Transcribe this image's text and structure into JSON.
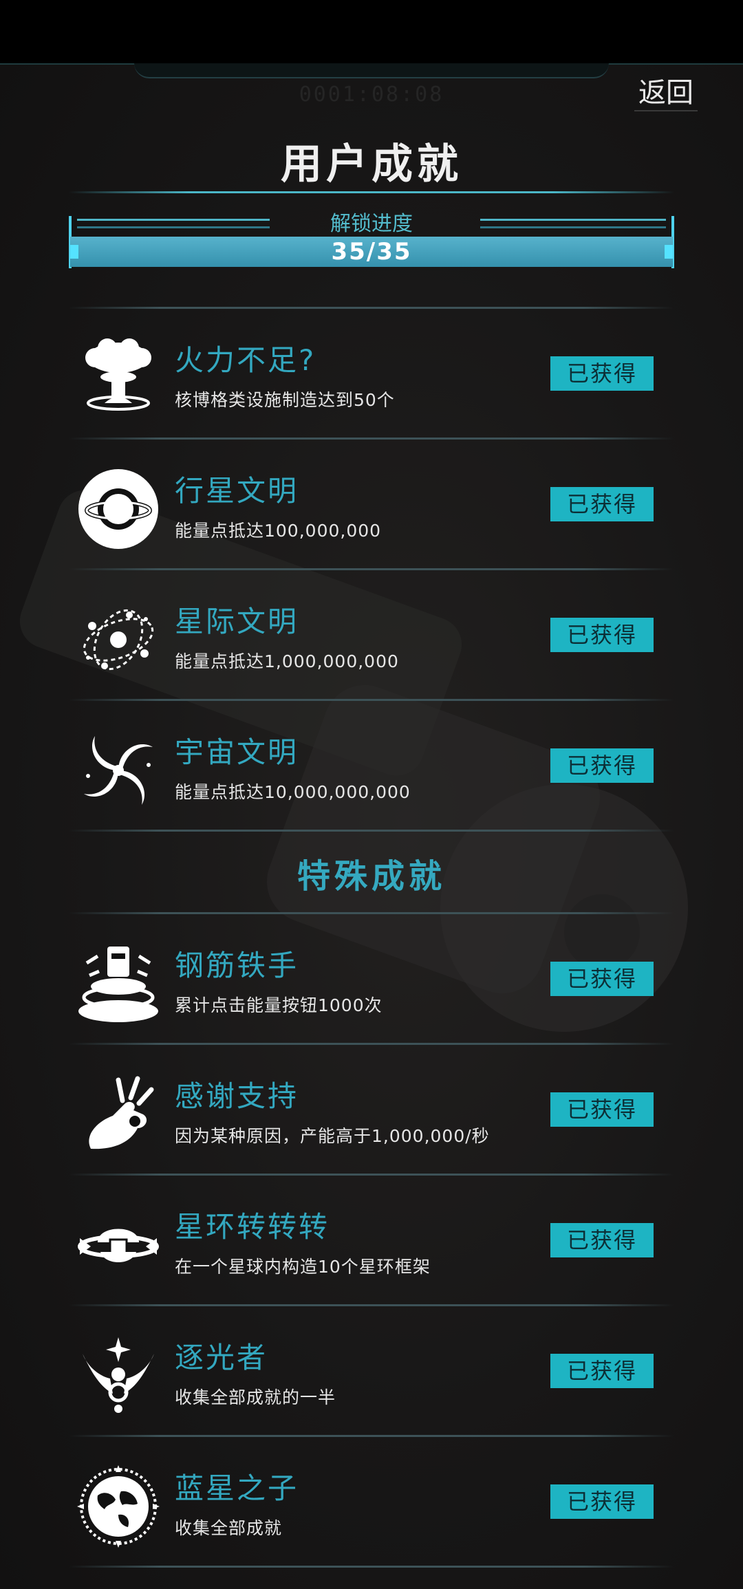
{
  "header": {
    "ghost_time": "0001:08:08",
    "back_label": "返回",
    "title": "用户成就"
  },
  "progress": {
    "label": "解锁进度",
    "text": "35/35",
    "fraction": 1.0
  },
  "achievements": [
    {
      "title": "火力不足?",
      "desc": "核博格类设施制造达到50个",
      "status": "已获得",
      "icon": "mushroom-cloud-icon"
    },
    {
      "title": "行星文明",
      "desc": "能量点抵达100,000,000",
      "status": "已获得",
      "icon": "planet-icon"
    },
    {
      "title": "星际文明",
      "desc": "能量点抵达1,000,000,000",
      "status": "已获得",
      "icon": "star-system-icon"
    },
    {
      "title": "宇宙文明",
      "desc": "能量点抵达10,000,000,000",
      "status": "已获得",
      "icon": "galaxy-spiral-icon"
    }
  ],
  "special_section_title": "特殊成就",
  "special_achievements": [
    {
      "title": "钢筋铁手",
      "desc": "累计点击能量按钮1000次",
      "status": "已获得",
      "icon": "press-button-icon"
    },
    {
      "title": "感谢支持",
      "desc": "因为某种原因，产能高于1,000,000/秒",
      "status": "已获得",
      "icon": "ok-hand-icon"
    },
    {
      "title": "星环转转转",
      "desc": "在一个星球内构造10个星环框架",
      "status": "已获得",
      "icon": "ring-frame-icon"
    },
    {
      "title": "逐光者",
      "desc": "收集全部成就的一半",
      "status": "已获得",
      "icon": "winged-light-icon"
    },
    {
      "title": "蓝星之子",
      "desc": "收集全部成就",
      "status": "已获得",
      "icon": "earth-emblem-icon"
    }
  ],
  "colors": {
    "accent": "#33a8c0",
    "badge": "#1eb4c3",
    "progress_fill": "#3d9cb8"
  }
}
